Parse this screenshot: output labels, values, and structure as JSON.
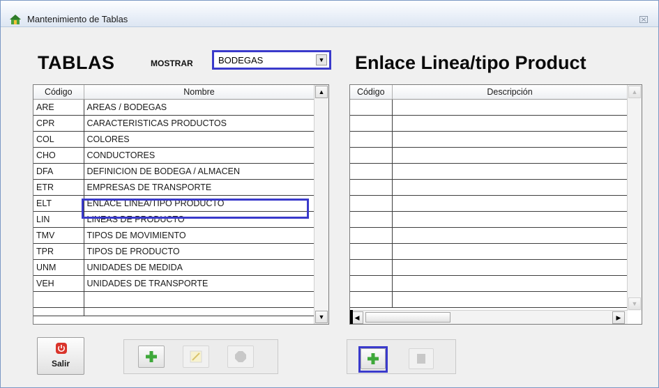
{
  "window": {
    "title": "Mantenimiento de Tablas",
    "close_glyph": "⌥"
  },
  "header": {
    "tablas_label": "TABLAS",
    "mostrar_label": "MOSTRAR",
    "mostrar_value": "BODEGAS",
    "right_title": "Enlace Linea/tipo Product"
  },
  "tablas_grid": {
    "columns": [
      "Código",
      "Nombre"
    ],
    "rows": [
      [
        "ARE",
        "AREAS / BODEGAS"
      ],
      [
        "CPR",
        "CARACTERISTICAS PRODUCTOS"
      ],
      [
        "COL",
        "COLORES"
      ],
      [
        "CHO",
        "CONDUCTORES"
      ],
      [
        "DFA",
        "DEFINICION DE BODEGA / ALMACEN"
      ],
      [
        "ETR",
        "EMPRESAS DE TRANSPORTE"
      ],
      [
        "ELT",
        "ENLACE LINEA/TIPO PRODUCTO"
      ],
      [
        "LIN",
        "LINEAS DE PRODUCTO"
      ],
      [
        "TMV",
        "TIPOS DE MOVIMIENTO"
      ],
      [
        "TPR",
        "TIPOS DE PRODUCTO"
      ],
      [
        "UNM",
        "UNIDADES DE MEDIDA"
      ],
      [
        "VEH",
        "UNIDADES DE TRANSPORTE"
      ]
    ],
    "selected_index": 6
  },
  "detail_grid": {
    "columns": [
      "Código",
      "Descripción"
    ]
  },
  "buttons": {
    "salir_label": "Salir",
    "icons": {
      "salir": "power-icon",
      "add": "plus-icon",
      "edit": "pencil-icon",
      "delete": "stop-icon",
      "detail_add": "plus-icon",
      "detail_delete": "square-icon"
    }
  },
  "colors": {
    "highlight": "#3a3acb",
    "plus_green": "#3ea83a",
    "salir_red": "#d9342b"
  }
}
